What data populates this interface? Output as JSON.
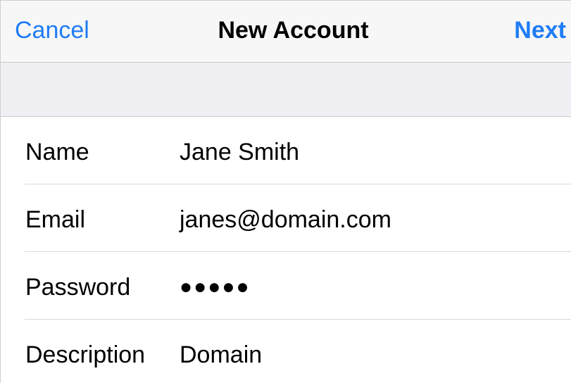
{
  "navbar": {
    "cancel_label": "Cancel",
    "title": "New Account",
    "next_label": "Next"
  },
  "form": {
    "fields": [
      {
        "label": "Name",
        "value": "Jane Smith"
      },
      {
        "label": "Email",
        "value": "janes@domain.com"
      },
      {
        "label": "Password",
        "value": "●●●●●"
      },
      {
        "label": "Description",
        "value": "Domain"
      }
    ]
  },
  "colors": {
    "accent": "#1f7cf5",
    "navbar_bg": "#f7f7f7",
    "group_bg": "#efeff4",
    "separator": "#d9d9de"
  }
}
